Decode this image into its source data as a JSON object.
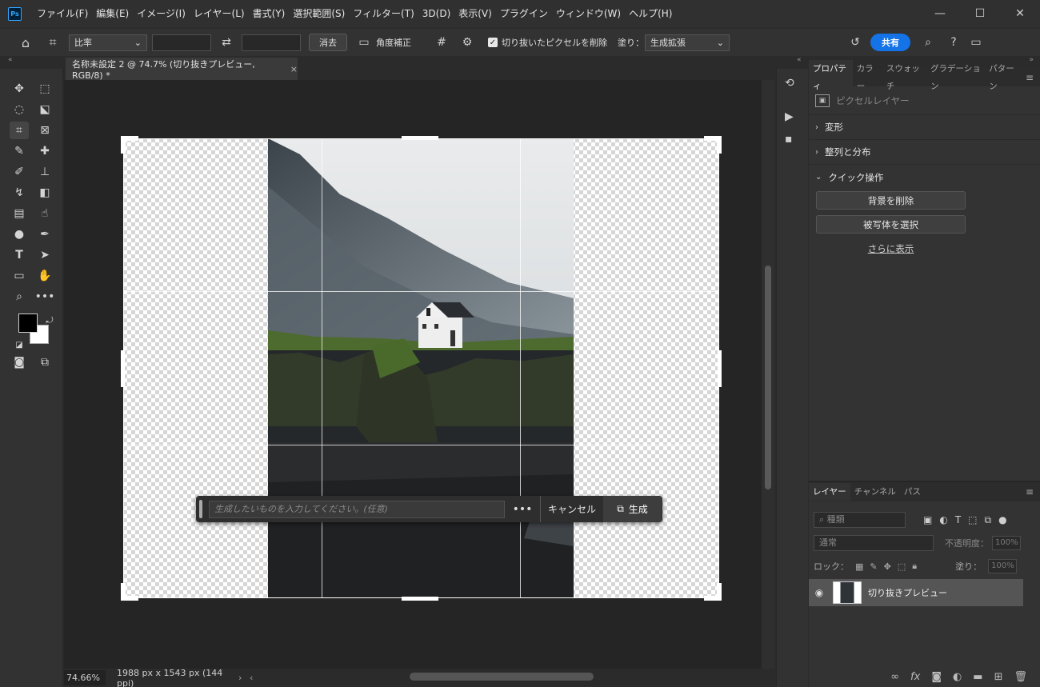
{
  "app": {
    "logo": "Ps",
    "menu": [
      "ファイル(F)",
      "編集(E)",
      "イメージ(I)",
      "レイヤー(L)",
      "書式(Y)",
      "選択範囲(S)",
      "フィルター(T)",
      "3D(D)",
      "表示(V)",
      "プラグイン",
      "ウィンドウ(W)",
      "ヘルプ(H)"
    ],
    "window_controls": [
      "—",
      "☐",
      "✕"
    ]
  },
  "options_bar": {
    "ratio_select": "比率",
    "clear_label": "消去",
    "straighten_label": "角度補正",
    "delete_cropped_label": "切り抜いたピクセルを削除",
    "fill_label": "塗り：",
    "fill_select": "生成拡張",
    "share_label": "共有"
  },
  "document": {
    "tab_title": "名称未設定 2 @ 74.7% (切り抜きプレビュー, RGB/8) *",
    "zoom": "74.66%",
    "doc_info": "1988 px x 1543 px (144 ppi)"
  },
  "generative_bar": {
    "placeholder": "生成したいものを入力してください。(任意)",
    "more": "•••",
    "cancel_label": "キャンセル",
    "generate_label": "生成"
  },
  "properties_panel": {
    "tabs": [
      "プロパティ",
      "カラー",
      "スウォッチ",
      "グラデーション",
      "パターン"
    ],
    "layer_type": "ピクセルレイヤー",
    "sections": [
      "変形",
      "整列と分布",
      "クイック操作"
    ],
    "quick_actions": [
      "背景を削除",
      "被写体を選択"
    ],
    "show_more": "さらに表示"
  },
  "layers_panel": {
    "tabs": [
      "レイヤー",
      "チャンネル",
      "パス"
    ],
    "filter_label": "種類",
    "blend_mode": "通常",
    "opacity_label": "不透明度：",
    "opacity_value": "100%",
    "lock_label": "ロック：",
    "fill_label": "塗り：",
    "fill_value": "100%",
    "layers": [
      {
        "name": "切り抜きプレビュー",
        "visible": true
      }
    ]
  },
  "colors": {
    "accent": "#1473e6",
    "foreground": "#000000",
    "background": "#ffffff"
  }
}
